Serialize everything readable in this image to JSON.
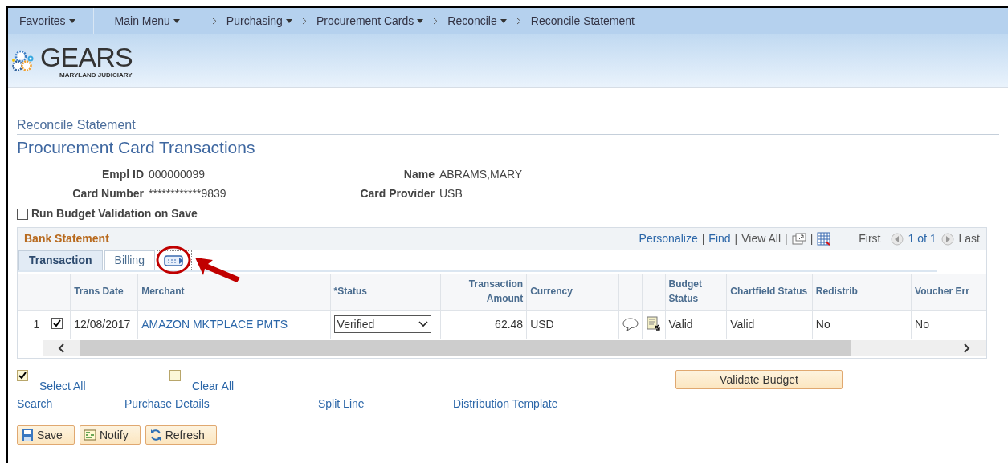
{
  "nav": [
    {
      "label": "Favorites",
      "dropdown": true
    },
    {
      "label": "Main Menu",
      "dropdown": true
    },
    {
      "label": "Purchasing",
      "dropdown": true
    },
    {
      "label": "Procurement Cards",
      "dropdown": true
    },
    {
      "label": "Reconcile",
      "dropdown": true
    },
    {
      "label": "Reconcile Statement",
      "dropdown": false
    }
  ],
  "logo": {
    "title": "GEARS",
    "subtitle": "MARYLAND JUDICIARY"
  },
  "breadcrumb": "Reconcile Statement",
  "page_title": "Procurement Card Transactions",
  "fields": [
    {
      "label": "Empl ID",
      "value": "000000099"
    },
    {
      "label": "Name",
      "value": "ABRAMS,MARY"
    },
    {
      "label": "Card Number",
      "value": "************9839"
    },
    {
      "label": "Card Provider",
      "value": "USB"
    }
  ],
  "budget_validation": {
    "label": "Run Budget Validation on Save",
    "checked": false
  },
  "grid": {
    "title": "Bank Statement",
    "links": [
      "Personalize",
      "Find"
    ],
    "view_all": "View All",
    "separator": "|",
    "first": "First",
    "count": "1 of 1",
    "last": "Last",
    "tabs": [
      {
        "kind": "text",
        "label": "Transaction",
        "selected": true
      },
      {
        "kind": "text",
        "label": "Billing",
        "selected": false
      },
      {
        "kind": "icon",
        "selected": false
      }
    ],
    "columns": [
      "",
      "",
      "Trans Date",
      "Merchant",
      "*Status",
      "Transaction Amount",
      "Currency",
      "",
      "",
      "Budget Status",
      "Chartfield Status",
      "Redistrib",
      "Voucher Err"
    ],
    "rows": [
      {
        "number": "1",
        "checked": true,
        "date": "12/08/2017",
        "merchant": "AMAZON MKTPLACE PMTS",
        "status": "Verified",
        "amount": "62.48",
        "currency": "USD",
        "budget_status": "Valid",
        "chartfield_status": "Valid",
        "redistrib": "No",
        "voucher_err": "No"
      }
    ]
  },
  "select_all": {
    "label": "Select All",
    "checked": true
  },
  "clear_all": {
    "label": "Clear All",
    "checked": false
  },
  "validate_button": "Validate Budget",
  "links": [
    "Search",
    "Purchase Details",
    "Split Line",
    "Distribution Template"
  ],
  "buttons": [
    {
      "kind": "save",
      "label": "Save"
    },
    {
      "kind": "notify",
      "label": "Notify"
    },
    {
      "kind": "refresh",
      "label": "Refresh"
    }
  ]
}
